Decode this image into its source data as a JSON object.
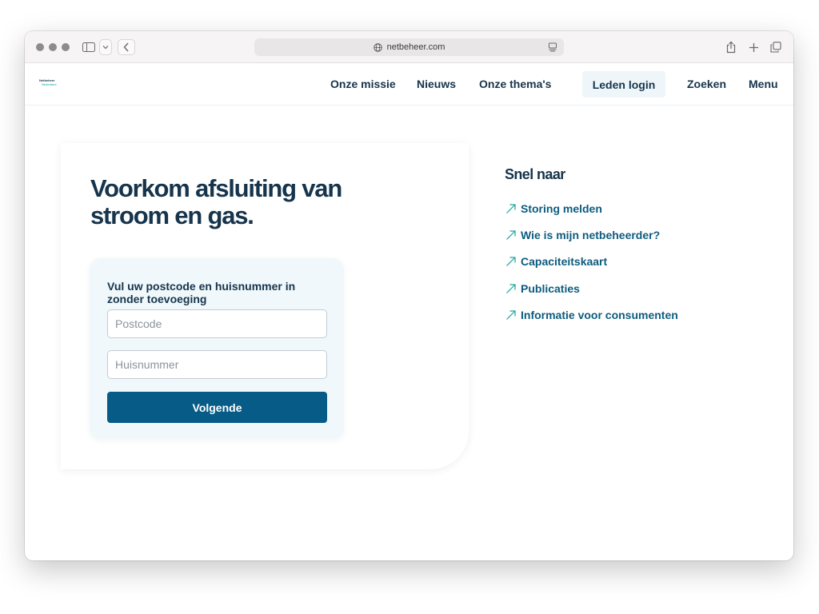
{
  "browser": {
    "url": "netbeheer.com"
  },
  "site": {
    "logo_line1": "Netbeheer",
    "logo_line2": "Nederland",
    "nav": {
      "mission": "Onze missie",
      "news": "Nieuws",
      "themes": "Onze thema's",
      "login": "Leden login",
      "search": "Zoeken",
      "menu": "Menu"
    }
  },
  "hero": {
    "title": "Voorkom afsluiting van stroom en gas."
  },
  "form": {
    "label": "Vul uw postcode en huisnummer in zonder toevoeging",
    "postcode_placeholder": "Postcode",
    "postcode_value": "",
    "huisnummer_placeholder": "Huisnummer",
    "huisnummer_value": "",
    "submit_label": "Volgende"
  },
  "quick_links": {
    "title": "Snel naar",
    "items": [
      {
        "label": "Storing melden",
        "icon": "arrow-up-right-icon"
      },
      {
        "label": "Wie is mijn netbeheerder?",
        "icon": "arrow-up-right-icon"
      },
      {
        "label": "Capaciteitskaart",
        "icon": "arrow-up-right-icon"
      },
      {
        "label": "Publicaties",
        "icon": "arrow-up-right-icon"
      },
      {
        "label": "Informatie voor consumenten",
        "icon": "arrow-up-right-icon"
      }
    ]
  },
  "colors": {
    "navy_text": "#16344c",
    "primary_button": "#065c86",
    "link": "#0d5b7e",
    "accent_teal": "#1aa7a0",
    "form_bg": "#f0f8fb"
  }
}
